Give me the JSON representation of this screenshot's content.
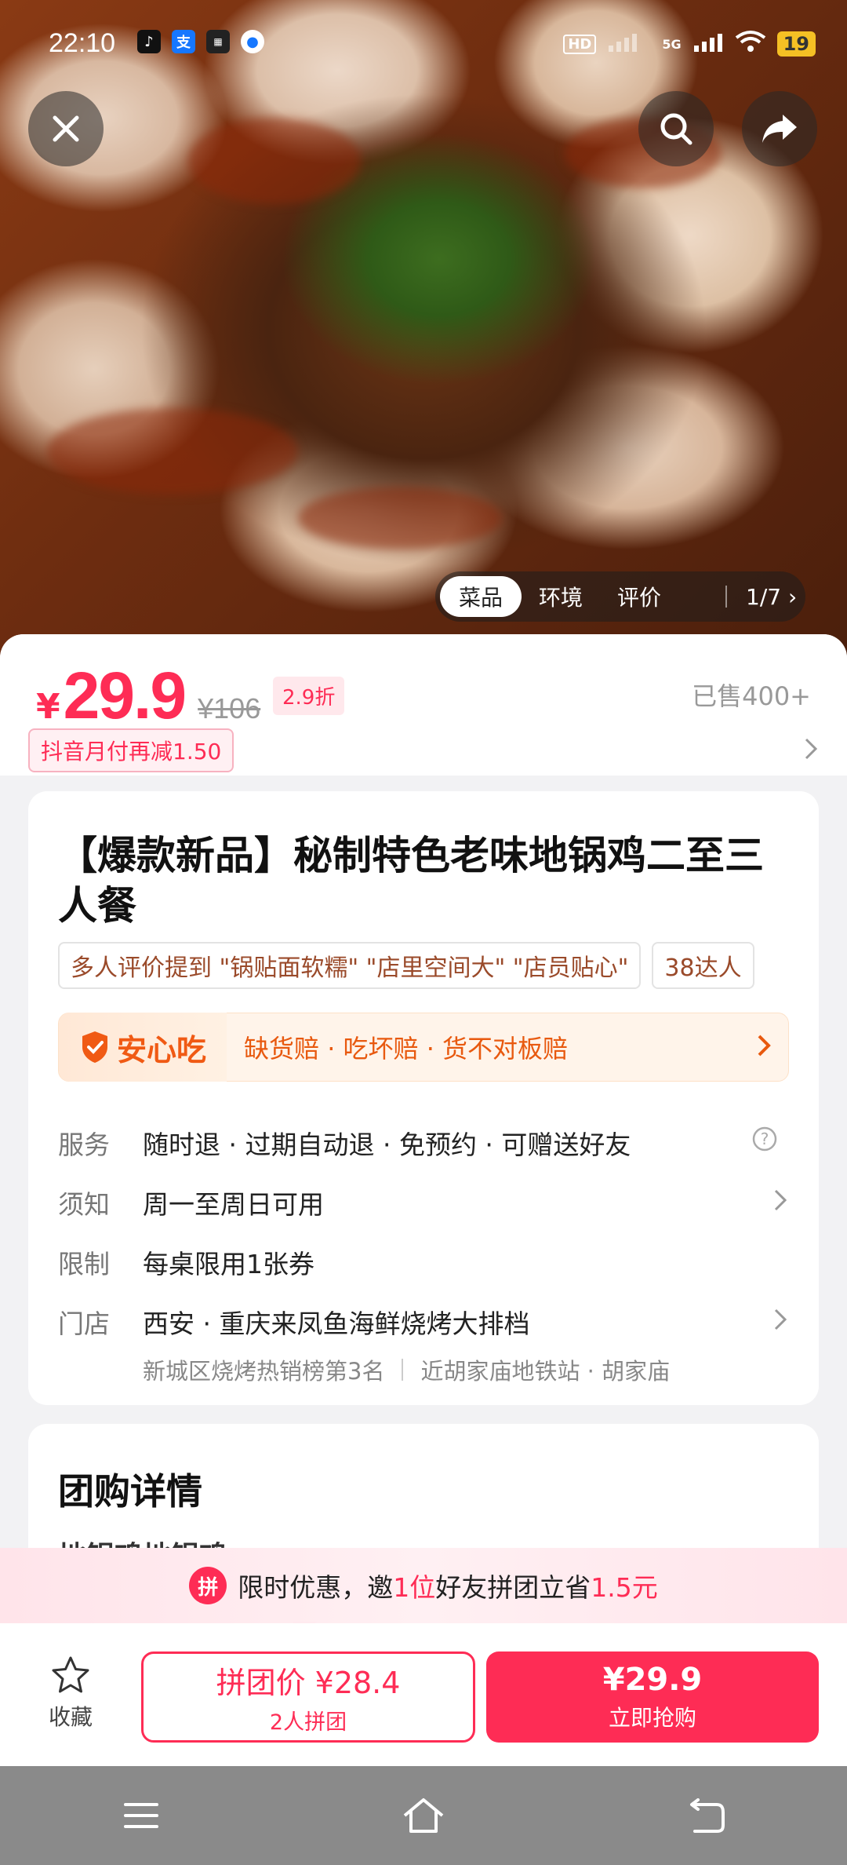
{
  "status_bar": {
    "time": "22:10",
    "battery": "19",
    "network": "5G",
    "hd": "HD"
  },
  "photo_tabs": {
    "items": [
      "菜品",
      "环境",
      "评价"
    ],
    "active": "菜品",
    "counter": "1/7 ›"
  },
  "price": {
    "currency": "¥",
    "current": "29.9",
    "original": "¥106",
    "discount": "2.9折",
    "sold": "已售400+",
    "coupon": "抖音月付再减1.50"
  },
  "product": {
    "title": "【爆款新品】秘制特色老味地锅鸡二至三人餐",
    "tags": [
      "多人评价提到 \"锅贴面软糯\" \"店里空间大\" \"店员贴心\"",
      "38达人"
    ]
  },
  "assurance": {
    "name": "安心吃",
    "text": "缺货赔 · 吃坏赔 · 货不对板赔"
  },
  "info": {
    "service_label": "服务",
    "service_value": "随时退 · 过期自动退 · 免预约 · 可赠送好友",
    "notice_label": "须知",
    "notice_value": "周一至周日可用",
    "limit_label": "限制",
    "limit_value": "每桌限用1张券",
    "store_label": "门店",
    "store_value": "西安 · 重庆来凤鱼海鲜烧烤大排档",
    "store_rank": "新城区烧烤热销榜第3名",
    "store_location": "近胡家庙地铁站 · 胡家庙"
  },
  "details": {
    "section_title": "团购详情",
    "peek_text": "地锅鸡地锅鸡"
  },
  "group_banner": {
    "icon": "拼",
    "prefix": "限时优惠，邀",
    "count": "1位",
    "middle": "好友拼团立省",
    "amount": "1.5元"
  },
  "actions": {
    "favorite": "收藏",
    "group_price": "拼团价 ¥28.4",
    "group_sub": "2人拼团",
    "buy_price": "¥29.9",
    "buy_sub": "立即抢购"
  },
  "colors": {
    "accent": "#fe2c55",
    "assurance": "#f05a14"
  }
}
